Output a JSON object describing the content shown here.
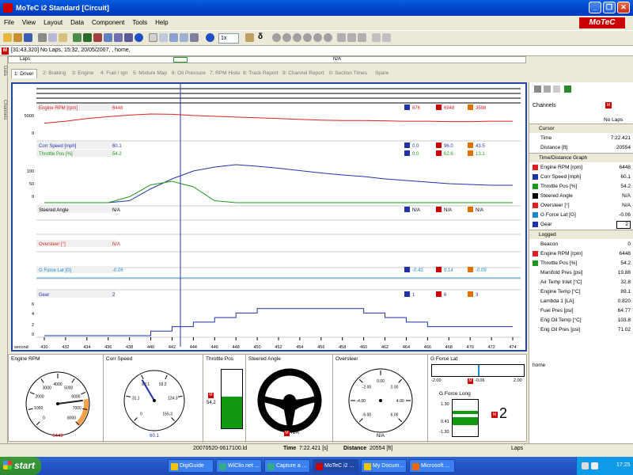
{
  "window": {
    "title": "MoTeC i2 Standard [Circuit]",
    "minimize": "_",
    "restore": "❐",
    "close": "✕"
  },
  "menu": [
    "File",
    "View",
    "Layout",
    "Data",
    "Component",
    "Tools",
    "Help"
  ],
  "logo": "MoTeC",
  "toolbar": {
    "zoom": "1x"
  },
  "infobar": {
    "text": "[31:43.320] No Laps, 15:32, 20/05/2007, , home,"
  },
  "lapsbar": {
    "label": "Laps",
    "value": "N/A"
  },
  "side_tabs": [
    "Data",
    "Channels"
  ],
  "tabs": [
    "1: Driver",
    "2: Braking",
    "3: Engine",
    "4: Fuel / Ign",
    "5: Mixture Map",
    "6: Oil Pressure",
    "7: RPM Histo",
    "8: Track Report",
    "9: Channel Report",
    "0: Section Times",
    "Spare"
  ],
  "graph": {
    "x_axis_label": "second",
    "x_ticks": [
      "430",
      "432",
      "434",
      "436",
      "438",
      "440",
      "442",
      "444",
      "446",
      "448",
      "450",
      "452",
      "454",
      "456",
      "458",
      "460",
      "462",
      "464",
      "466",
      "468",
      "470",
      "472",
      "474"
    ],
    "panes": [
      {
        "name": "Engine RPM [rpm]",
        "value": "6448",
        "min": "876",
        "max": "6948",
        "avg": "3598",
        "color": "#d22",
        "yticks": [
          "5000",
          "0"
        ]
      },
      {
        "name": "Corr Speed [mph]",
        "value": "60.1",
        "min": "0.0",
        "max": "96.0",
        "avg": "43.5",
        "color": "#2233aa",
        "yticks": [
          "100",
          "50",
          "0"
        ]
      },
      {
        "name": "Throttle Pos [%]",
        "value": "54.2",
        "min": "0.0",
        "max": "62.6",
        "avg": "13.1",
        "color": "#1a9a1a"
      },
      {
        "name": "Steered Angle",
        "value": "N/A",
        "min": "N/A",
        "max": "N/A",
        "avg": "N/A",
        "color": "#000"
      },
      {
        "name": "Oversteer [°]",
        "value": "N/A",
        "color": "#d22"
      },
      {
        "name": "G Force Lat [G]",
        "value": "-0.06",
        "min": "-0.43",
        "max": "0.14",
        "avg": "-0.09",
        "color": "#1a8acc"
      },
      {
        "name": "Gear",
        "value": "2",
        "min": "1",
        "max": "6",
        "avg": "3",
        "color": "#2233aa",
        "yticks": [
          "6",
          "4",
          "2",
          "0"
        ]
      }
    ]
  },
  "gauges": {
    "engine_rpm": {
      "title": "Engine RPM",
      "ticks": [
        "0",
        "1000",
        "2000",
        "3000",
        "4000",
        "5000",
        "6000",
        "7000",
        "8000"
      ],
      "value": "6448"
    },
    "corr_speed": {
      "title": "Corr Speed",
      "ticks": [
        "0",
        "31.1",
        "62.1",
        "93.2",
        "124.3",
        "155.3"
      ],
      "value": "60.1"
    },
    "throttle": {
      "title": "Throttle Pos",
      "value": "54.2",
      "fraction": 0.542
    },
    "steered": {
      "title": "Steered Angle",
      "value": "N/A"
    },
    "oversteer": {
      "title": "Oversteer",
      "ticks": [
        "-6.00",
        "-4.00",
        "-2.00",
        "0.00",
        "2.00",
        "4.00",
        "6.00"
      ],
      "value": "N/A"
    },
    "gforce_lat": {
      "title": "G Force Lat",
      "ticks": [
        "-2.00",
        "0.00",
        "2.00"
      ],
      "value": "-0.06"
    },
    "gforce_long": {
      "title": "G Force Long",
      "ticks": [
        "1.30",
        "0.41",
        "-1.30"
      ]
    },
    "gear": {
      "value": "2"
    }
  },
  "right_panel": {
    "header": "Channels",
    "no_laps": "No Laps",
    "sections": [
      {
        "title": "Cursor",
        "rows": [
          {
            "label": "Time",
            "value": "7:22.421"
          },
          {
            "label": "Distance [ft]",
            "value": "20554"
          }
        ]
      },
      {
        "title": "Time/Distance Graph",
        "rows": [
          {
            "label": "Engine RPM [rpm]",
            "value": "6448",
            "color": "#d22"
          },
          {
            "label": "Corr Speed [mph]",
            "value": "60.1",
            "color": "#2233aa"
          },
          {
            "label": "Throttle Pos [%]",
            "value": "54.2",
            "color": "#1a9a1a"
          },
          {
            "label": "Steered Angle",
            "value": "N/A",
            "color": "#000"
          },
          {
            "label": "Oversteer [°]",
            "value": "N/A",
            "color": "#d22"
          },
          {
            "label": "G Force Lat [G]",
            "value": "-0.06",
            "color": "#1a8acc"
          },
          {
            "label": "Gear",
            "value": "2",
            "color": "#2233aa"
          }
        ]
      },
      {
        "title": "Logged",
        "rows": [
          {
            "label": "Beacon",
            "value": "0"
          },
          {
            "label": "Engine RPM [rpm]",
            "value": "6448",
            "color": "#d22"
          },
          {
            "label": "Throttle Pos [%]",
            "value": "54.2",
            "color": "#1a9a1a"
          },
          {
            "label": "Manifold Pres [psi]",
            "value": "19.88"
          },
          {
            "label": "Air Temp Inlet [°C]",
            "value": "32.8"
          },
          {
            "label": "Engine Temp [°C]",
            "value": "89.1"
          },
          {
            "label": "Lambda 1 [LA]",
            "value": "0.820"
          },
          {
            "label": "Fuel Pres [psi]",
            "value": "64.77"
          },
          {
            "label": "Eng Oil Temp [°C]",
            "value": "103.8"
          },
          {
            "label": "Eng Oil Pres [psi]",
            "value": "71.02"
          }
        ]
      }
    ],
    "footer": "home"
  },
  "status": {
    "file": "20070520-0617100.ld",
    "time_label": "Time",
    "time_value": "7:22.421 [s]",
    "dist_label": "Distance",
    "dist_value": "20554 [ft]",
    "laps": "Laps"
  },
  "taskbar": {
    "start": "start",
    "items": [
      "DigiGuide",
      "WiClio.net ...",
      "Capture a ...",
      "MoTeC i2 ...",
      "My Docum...",
      "Microsoft ..."
    ],
    "clock": "17:25"
  },
  "chart_data": [
    {
      "type": "line",
      "title": "",
      "xlabel": "second",
      "x": [
        430,
        432,
        434,
        436,
        438,
        440,
        442,
        444,
        446,
        448,
        450,
        452,
        454,
        456,
        458,
        460,
        462,
        464,
        466,
        468,
        470,
        472,
        474
      ],
      "series": [
        {
          "name": "Engine RPM [rpm]",
          "values": [
            4200,
            4700,
            5400,
            5900,
            6300,
            6600,
            6500,
            6200,
            6000,
            5800,
            5600,
            5400,
            5200,
            5000,
            4900,
            4900,
            4800,
            4700,
            4700,
            4600,
            4600,
            4700,
            4700
          ]
        },
        {
          "name": "Corr Speed [mph]",
          "values": [
            0,
            0,
            0,
            0,
            5,
            35,
            60,
            80,
            90,
            96,
            92,
            87,
            81,
            75,
            70,
            66,
            60,
            56,
            52,
            48,
            46,
            44,
            44
          ]
        },
        {
          "name": "Throttle Pos [%]",
          "values": [
            0,
            0,
            0,
            0,
            15,
            45,
            54,
            40,
            5,
            0,
            0,
            0,
            0,
            0,
            0,
            0,
            0,
            0,
            0,
            0,
            0,
            0,
            0
          ]
        },
        {
          "name": "Gear",
          "values": [
            0,
            0,
            0,
            0,
            0,
            1,
            2,
            3,
            4,
            5,
            6,
            6,
            6,
            6,
            6,
            5,
            4,
            3,
            2,
            2,
            2,
            2,
            2
          ]
        }
      ]
    }
  ]
}
